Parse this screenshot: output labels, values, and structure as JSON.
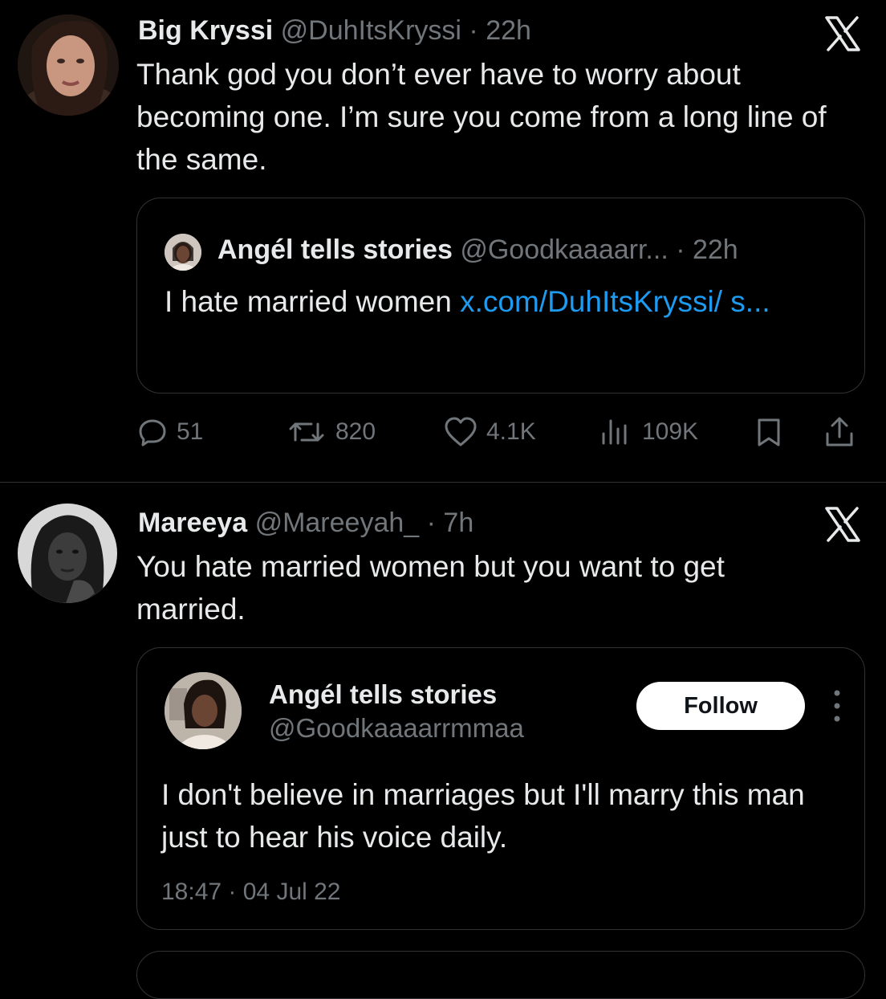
{
  "tweet1": {
    "name": "Big Kryssi",
    "handle": "@DuhItsKryssi",
    "time": "22h",
    "text": "Thank god you don’t ever have to worry about becoming one. I’m sure you come from a long line of the same.",
    "quote": {
      "name": "Angél tells stories",
      "handle": "@Goodkaaaarr...",
      "time": "22h",
      "text": "I hate married women ",
      "link": "x.com/DuhItsKryssi/ s..."
    },
    "actions": {
      "replies": "51",
      "retweets": "820",
      "likes": "4.1K",
      "views": "109K"
    }
  },
  "tweet2": {
    "name": "Mareeya",
    "handle": "@Mareeyah_",
    "time": "7h",
    "text": "You hate married women but you want to get married.",
    "embed": {
      "name": "Angél tells stories",
      "handle": "@Goodkaaaarrmmaa",
      "follow_label": "Follow",
      "text": "I don't believe in marriages but I'll marry this man just to hear his voice daily.",
      "timestamp": "18:47 · 04 Jul 22"
    }
  },
  "colors": {
    "background": "#000000",
    "text": "#e7e9ea",
    "muted": "#71767b",
    "link": "#1d9bf0",
    "border": "#2f3336"
  }
}
